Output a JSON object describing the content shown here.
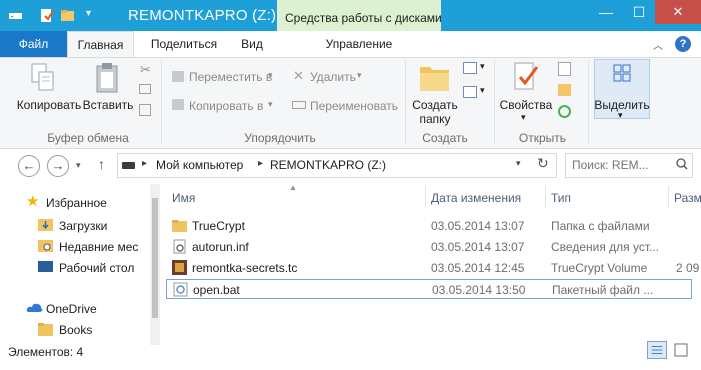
{
  "window": {
    "title": "REMONTKAPRO (Z:)",
    "context_tools": "Средства работы с дисками",
    "minimize": "—",
    "maximize": "☐",
    "close": "✕"
  },
  "tabs": {
    "file": "Файл",
    "home": "Главная",
    "share": "Поделиться",
    "view": "Вид",
    "manage": "Управление"
  },
  "ribbon": {
    "clipboard": {
      "label": "Буфер обмена",
      "copy": "Копировать",
      "paste": "Вставить"
    },
    "organize": {
      "label": "Упорядочить",
      "move_to": "Переместить в",
      "copy_to": "Копировать в",
      "delete": "Удалить",
      "rename": "Переименовать"
    },
    "new": {
      "label": "Создать",
      "new_folder_line1": "Создать",
      "new_folder_line2": "папку"
    },
    "open": {
      "label": "Открыть",
      "properties": "Свойства"
    },
    "select": {
      "label": "Выделить"
    }
  },
  "address": {
    "computer": "Мой компьютер",
    "drive": "REMONTKAPRO (Z:)",
    "search_placeholder": "Поиск: REM..."
  },
  "nav_pane": {
    "favorites": "Избранное",
    "items": [
      {
        "label": "Загрузки",
        "icon": "downloads-folder-icon"
      },
      {
        "label": "Недавние мес",
        "icon": "recent-places-icon"
      },
      {
        "label": "Рабочий стол",
        "icon": "desktop-icon"
      }
    ],
    "onedrive": "OneDrive",
    "onedrive_items": [
      {
        "label": "Books",
        "icon": "folder-icon"
      }
    ]
  },
  "columns": {
    "name": "Имя",
    "date": "Дата изменения",
    "type": "Тип",
    "size": "Разм"
  },
  "files": [
    {
      "name": "TrueCrypt",
      "date": "03.05.2014 13:07",
      "type": "Папка с файлами",
      "size": "",
      "icon": "folder-icon",
      "selected": false
    },
    {
      "name": "autorun.inf",
      "date": "03.05.2014 13:07",
      "type": "Сведения для уст...",
      "size": "",
      "icon": "settings-file-icon",
      "selected": false
    },
    {
      "name": "remontka-secrets.tc",
      "date": "03.05.2014 12:45",
      "type": "TrueCrypt Volume",
      "size": "2 09",
      "icon": "truecrypt-volume-icon",
      "selected": false
    },
    {
      "name": "open.bat",
      "date": "03.05.2014 13:50",
      "type": "Пакетный файл ...",
      "size": "",
      "icon": "batch-file-icon",
      "selected": true
    }
  ],
  "status": {
    "items_count": "Элементов: 4"
  },
  "colors": {
    "titlebar": "#1e9fd7",
    "file_tab": "#1978c7",
    "context_tab": "#dcf1d2",
    "close": "#c7504b"
  }
}
